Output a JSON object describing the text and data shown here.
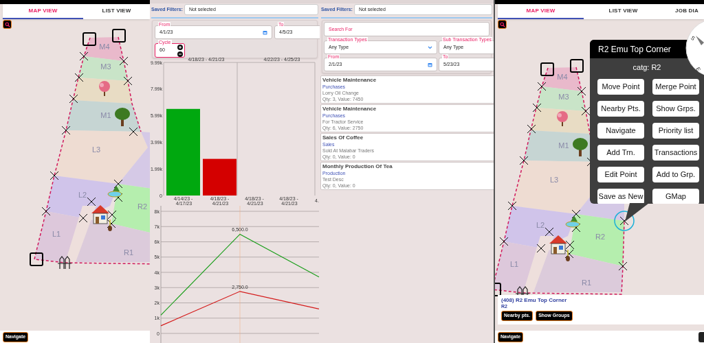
{
  "left_map": {
    "tabs": [
      {
        "label": "MAP VIEW",
        "selected": true
      },
      {
        "label": "LIST VIEW",
        "selected": false
      }
    ],
    "plot_labels": [
      "M4",
      "M3",
      "M1",
      "L3",
      "L2",
      "R2",
      "L1",
      "R1"
    ],
    "bottom_button": "Navigate"
  },
  "summary_panel": {
    "saved_filters": {
      "label": "Saved Filters:",
      "value": "Not selected"
    },
    "from": {
      "label": "From",
      "value": "4/1/23"
    },
    "to": {
      "label": "To",
      "value": "4/5/23"
    },
    "cycle": {
      "label": "Cycle",
      "value": "60"
    },
    "top_labels": [
      "4/18/23 - 4/21/23",
      "4/22/23 - 4/25/23"
    ],
    "extra_x_labels": [
      "4/18/23 - 4/21/23",
      "4/18/23 - 4/21/23",
      "4."
    ],
    "bar_chart": {
      "chart_data": {
        "type": "bar",
        "categories": [
          "4/14/23 - 4/17/23",
          "4/18/23 - 4/21/23"
        ],
        "series": [
          {
            "color": "#00a80f",
            "values": [
              6.5,
              null
            ]
          },
          {
            "color": "#d40000",
            "values": [
              null,
              2.75
            ]
          }
        ],
        "ylim": [
          0,
          9.99
        ],
        "yticks": [
          {
            "value": 0,
            "label": "0"
          },
          {
            "value": 1.99,
            "label": "1.99k"
          },
          {
            "value": 3.99,
            "label": "3.99k"
          },
          {
            "value": 5.99,
            "label": "5.99k"
          },
          {
            "value": 7.99,
            "label": "7.99k"
          },
          {
            "value": 9.99,
            "label": "9.99k"
          }
        ]
      }
    },
    "line_chart": {
      "chart_data": {
        "type": "line",
        "categories": [
          null,
          null,
          null
        ],
        "ylim": [
          0,
          8
        ],
        "grid": true,
        "yticks": [
          {
            "value": 0,
            "label": "0"
          },
          {
            "value": 1,
            "label": "1k"
          },
          {
            "value": 2,
            "label": "2k"
          },
          {
            "value": 3,
            "label": "3k"
          },
          {
            "value": 4,
            "label": "4k"
          },
          {
            "value": 5,
            "label": "5k"
          },
          {
            "value": 6,
            "label": "6k"
          },
          {
            "value": 7,
            "label": "7k"
          },
          {
            "value": 8,
            "label": "8k"
          }
        ],
        "series": [
          {
            "color": "#1a9e1a",
            "values": [
              1.2,
              6.5,
              3.7
            ]
          },
          {
            "color": "#d41a1a",
            "values": [
              0.5,
              2.75,
              1.6
            ]
          }
        ],
        "annotations": [
          {
            "y": 6.5,
            "text": "6,500.0"
          },
          {
            "y": 2.75,
            "text": "2,750.0"
          }
        ]
      }
    }
  },
  "transactions_panel": {
    "saved_filters": {
      "label": "Saved Filters:",
      "value": "Not selected"
    },
    "search": {
      "placeholder": "Search For"
    },
    "transaction_types": {
      "label": "Transaction Types",
      "value": "Any Type"
    },
    "sub_transaction_types": {
      "label": "Sub Transaction Types",
      "value": "Any Type"
    },
    "from": {
      "label": "From",
      "value": "2/1/23"
    },
    "to": {
      "label": "To",
      "value": "5/23/23"
    },
    "items": [
      {
        "title": "Vehicle Maintenance",
        "type": "Purchases",
        "description": "Lorry Oil Change",
        "details": "Qty: 3, Value: 7450"
      },
      {
        "title": "Vehicle Maintenance",
        "type": "Purchases",
        "description": "For Tractor Service",
        "details": "Qty: 6, Value: 2750"
      },
      {
        "title": "Sales Of Coffee",
        "type": "Sales",
        "description": "Sold At Malabar Traders",
        "details": "Qty: 0, Value: 0"
      },
      {
        "title": "Monthly Production Of Tea",
        "type": "Production",
        "description": "Test Desc",
        "details": "Qty: 0, Value: 0"
      }
    ]
  },
  "right_map": {
    "tabs": [
      {
        "label": "MAP VIEW",
        "selected": true
      },
      {
        "label": "LIST VIEW",
        "selected": false
      },
      {
        "label": "JOB DIA",
        "selected": false
      }
    ],
    "plot_labels": [
      "M4",
      "M3",
      "M1",
      "L3",
      "L2",
      "R2",
      "L1",
      "R1"
    ],
    "compass_letters": [
      "S",
      "E"
    ],
    "popup": {
      "title": "R2 Emu Top Corner",
      "category": "catg: R2",
      "buttons": [
        "Move Point",
        "Merge Point",
        "Nearby Pts.",
        "Show Grps.",
        "Navigate",
        "Priority list",
        "Add Trn.",
        "Transactions",
        "Edit Point",
        "Add to Grp.",
        "Save as New",
        "GMap"
      ]
    },
    "point_card": {
      "title": "(408) R2 Emu Top Corner",
      "subtitle": "R2",
      "buttons": [
        "Nearby pts.",
        "Show Groups"
      ]
    },
    "bottom_button": "Navigate"
  }
}
